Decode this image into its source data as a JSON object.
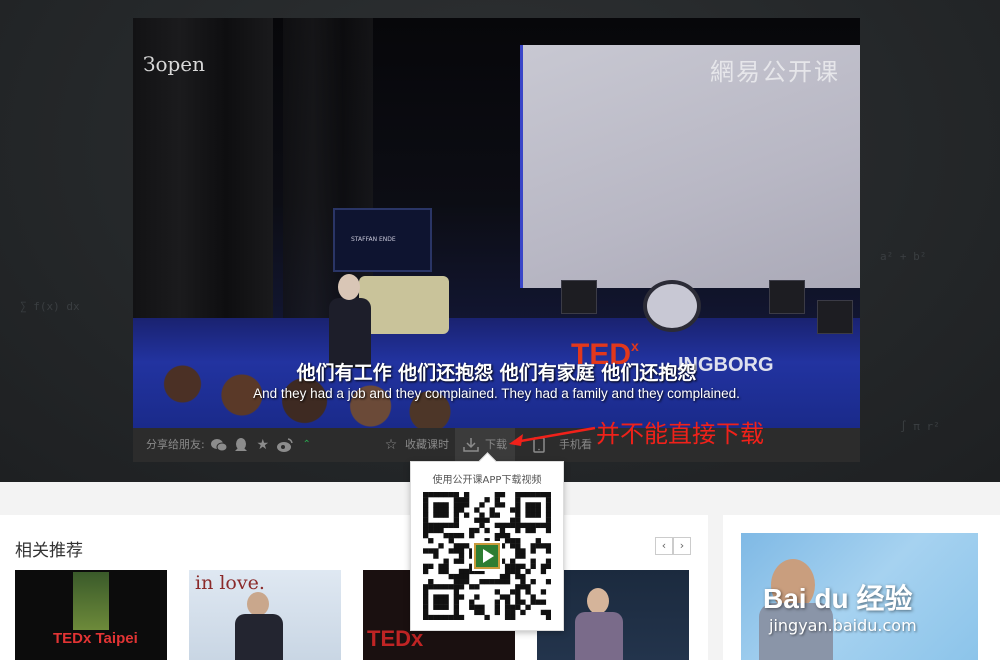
{
  "video": {
    "watermark": "網易公开课",
    "corner_text": "Зopen",
    "tv_text": "STAFFAN ENDE",
    "stage_logo": "TED",
    "stage_logo_suffix": "x",
    "stage_location": "INGBORG",
    "subtitle_cn": "他们有工作 他们还抱怨  他们有家庭 他们还抱怨",
    "subtitle_en": "And they had a job and they complained. They had a family and they complained."
  },
  "toolbar": {
    "share_label": "分享给朋友:",
    "favorite_label": "收藏课时",
    "download_label": "下载",
    "mobile_label": "手机看"
  },
  "icons": {
    "wechat": "wechat-icon",
    "qq": "qq-icon",
    "star": "star-icon",
    "weibo": "weibo-icon",
    "more": "chevron-up-icon",
    "favorite": "star-outline-icon",
    "download": "download-icon",
    "mobile": "phone-icon"
  },
  "annotation": "并不能直接下载",
  "qr_popup": {
    "title": "使用公开课APP下载视频"
  },
  "related": {
    "title": "相关推荐",
    "prev": "‹",
    "next": "›",
    "thumbs": [
      {
        "overlay": "TEDx Taipei"
      },
      {
        "overlay": "in love."
      },
      {
        "overlay": "TEDx"
      },
      {
        "overlay": ""
      }
    ]
  },
  "side_ad": {
    "brand": "Bai du 经验",
    "url": "jingyan.baidu.com"
  },
  "colors": {
    "annotation": "#f0211a",
    "ted_red": "#e2381c",
    "toolbar_bg": "#2c2c2c"
  }
}
